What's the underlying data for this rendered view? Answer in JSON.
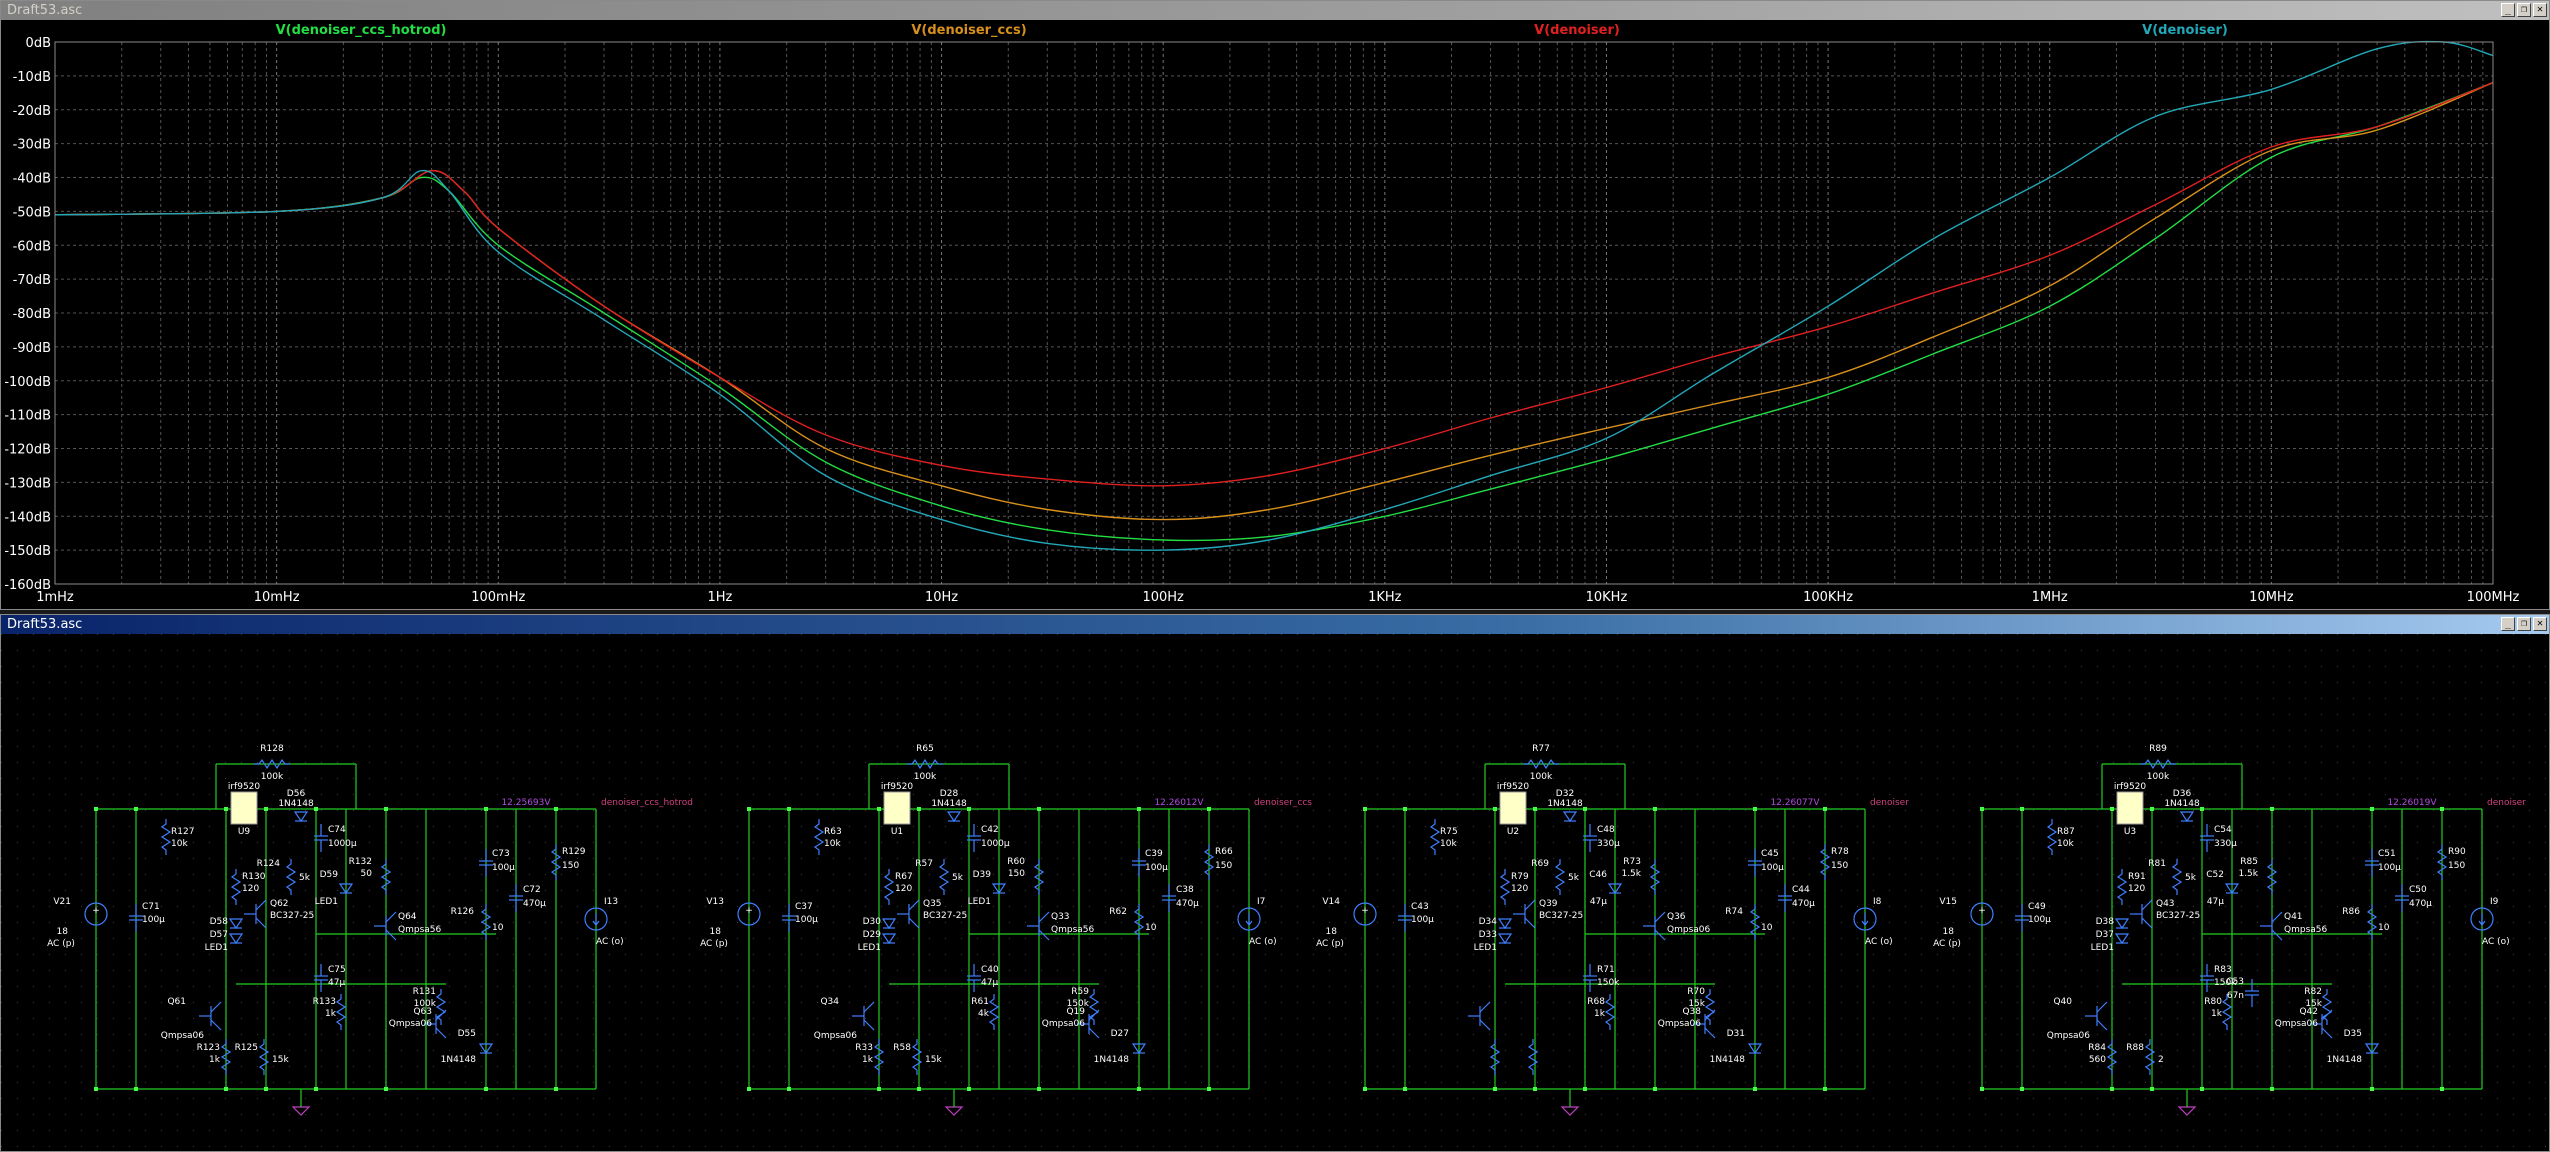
{
  "plot_window": {
    "title": "Draft53.asc"
  },
  "schematic_window": {
    "title": "Draft53.asc"
  },
  "window_controls": {
    "minimize": "_",
    "restore": "❐",
    "close": "✕"
  },
  "chart_data": {
    "type": "line",
    "title": "",
    "xlabel": "",
    "ylabel": "",
    "x_scale": "log",
    "xlim": [
      "1mHz",
      "100MHz"
    ],
    "ylim": [
      -160,
      0
    ],
    "grid": true,
    "legend": "top",
    "x_ticks": [
      "1mHz",
      "10mHz",
      "100mHz",
      "1Hz",
      "10Hz",
      "100Hz",
      "1KHz",
      "10KHz",
      "100KHz",
      "1MHz",
      "10MHz",
      "100MHz"
    ],
    "y_ticks": [
      "0dB",
      "-10dB",
      "-20dB",
      "-30dB",
      "-40dB",
      "-50dB",
      "-60dB",
      "-70dB",
      "-80dB",
      "-90dB",
      "-100dB",
      "-110dB",
      "-120dB",
      "-130dB",
      "-140dB",
      "-150dB",
      "-160dB"
    ],
    "series": [
      {
        "name": "V(denoiser_ccs_hotrod)",
        "color": "#22dd44",
        "x": [
          "1mHz",
          "10mHz",
          "30mHz",
          "45mHz",
          "60mHz",
          "100mHz",
          "300mHz",
          "1Hz",
          "3Hz",
          "10Hz",
          "30Hz",
          "100Hz",
          "300Hz",
          "1KHz",
          "3KHz",
          "10KHz",
          "30KHz",
          "100KHz",
          "300KHz",
          "1MHz",
          "3MHz",
          "10MHz",
          "30MHz",
          "100MHz"
        ],
        "y": [
          -51,
          -50,
          -46,
          -40,
          -44,
          -60,
          -80,
          -102,
          -124,
          -137,
          -144,
          -147,
          -146,
          -140,
          -132,
          -123,
          -114,
          -104,
          -92,
          -78,
          -58,
          -34,
          -25,
          -12
        ]
      },
      {
        "name": "V(denoiser_ccs)",
        "color": "#d8901c",
        "x": [
          "1mHz",
          "10mHz",
          "30mHz",
          "50mHz",
          "70mHz",
          "100mHz",
          "300mHz",
          "1Hz",
          "3Hz",
          "10Hz",
          "30Hz",
          "100Hz",
          "300Hz",
          "1KHz",
          "3KHz",
          "10KHz",
          "30KHz",
          "100KHz",
          "300KHz",
          "1MHz",
          "3MHz",
          "10MHz",
          "30MHz",
          "100MHz"
        ],
        "y": [
          -51,
          -50,
          -46,
          -38,
          -44,
          -55,
          -78,
          -99,
          -120,
          -131,
          -138,
          -141,
          -138,
          -130,
          -122,
          -114,
          -107,
          -99,
          -87,
          -72,
          -52,
          -32,
          -26,
          -12
        ]
      },
      {
        "name": "V(denoiser)",
        "color": "#e02020",
        "x": [
          "1mHz",
          "10mHz",
          "30mHz",
          "50mHz",
          "70mHz",
          "100mHz",
          "300mHz",
          "1Hz",
          "3Hz",
          "10Hz",
          "30Hz",
          "100Hz",
          "300Hz",
          "1KHz",
          "3KHz",
          "10KHz",
          "30KHz",
          "100KHz",
          "300KHz",
          "1MHz",
          "3MHz",
          "10MHz",
          "30MHz",
          "100MHz"
        ],
        "y": [
          -51,
          -50,
          -46,
          -38,
          -44,
          -55,
          -78,
          -99,
          -116,
          -125,
          -129,
          -131,
          -128,
          -120,
          -111,
          -102,
          -93,
          -84,
          -74,
          -63,
          -48,
          -31,
          -25,
          -12
        ]
      },
      {
        "name": "V(denoiser)",
        "color": "#22a8b8",
        "x": [
          "1mHz",
          "10mHz",
          "30mHz",
          "45mHz",
          "60mHz",
          "100mHz",
          "300mHz",
          "1Hz",
          "3Hz",
          "10Hz",
          "30Hz",
          "100Hz",
          "300Hz",
          "1KHz",
          "3KHz",
          "10KHz",
          "30KHz",
          "100KHz",
          "300KHz",
          "1MHz",
          "3MHz",
          "10MHz",
          "30MHz",
          "60MHz",
          "100MHz"
        ],
        "y": [
          -51,
          -50,
          -46,
          -38,
          -44,
          -62,
          -82,
          -104,
          -128,
          -141,
          -148,
          -150,
          -147,
          -138,
          -128,
          -117,
          -98,
          -78,
          -58,
          -40,
          -22,
          -14,
          -2,
          0,
          -4
        ]
      }
    ]
  },
  "schematic": {
    "circuits": [
      {
        "mosfet": "irf9520",
        "mos_ref": "U9",
        "rfb": "R128",
        "rfb_val": "100k",
        "rtop": "R127",
        "rtop_val": "10k",
        "vsrc": "V21",
        "vsrc_val": "18",
        "ac_label": "AC (p)",
        "cin": "C71",
        "cin_val": "100µ",
        "diode": "D56",
        "diode_val": "1N4148",
        "cfilt": "C74",
        "cfilt_val": "1000µ",
        "r3": "R130",
        "r3_val": "120",
        "q1": "Q62",
        "q1_val": "BC327-25",
        "led": "D58",
        "led2": "D57",
        "led_val": "LED1",
        "r4": "R124",
        "r4_val": "5k",
        "d3": "D59",
        "d3_val": "LED1",
        "r5": "R132",
        "r5_val": "50",
        "q2": "Q64",
        "q2_val": "Qmpsa56",
        "c3": "C73",
        "c3_val": "100µ",
        "r6": "R129",
        "r6_val": "150",
        "c4": "C72",
        "c4_val": "470µ",
        "r7": "R126",
        "r7_val": "10",
        "c5": "C75",
        "c5_val": "47µ",
        "r8": "R133",
        "r8_val": "1k",
        "r9": "R131",
        "r9_val": "100k",
        "q3": "Q63",
        "q3_val": "Qmpsa06",
        "d4": "D55",
        "d4_val": "1N4148",
        "q4": "Q61",
        "q4_val": "Qmpsa06",
        "r10": "R123",
        "r10_val": "1k",
        "r11": "R125",
        "r11_val": "15k",
        "isrc": "I13",
        "isrc_ac": "AC (o)",
        "voltage": "12.25693V",
        "net": "denoiser_ccs_hotrod"
      },
      {
        "mosfet": "irf9520",
        "mos_ref": "U1",
        "rfb": "R65",
        "rfb_val": "100k",
        "rtop": "R63",
        "rtop_val": "10k",
        "vsrc": "V13",
        "vsrc_val": "18",
        "ac_label": "AC (p)",
        "cin": "C37",
        "cin_val": "100µ",
        "diode": "D28",
        "diode_val": "1N4148",
        "cfilt": "C42",
        "cfilt_val": "1000µ",
        "r3": "R67",
        "r3_val": "120",
        "q1": "Q35",
        "q1_val": "BC327-25",
        "led": "D30",
        "led2": "D29",
        "led_val": "LED1",
        "r4": "R57",
        "r4_val": "5k",
        "d3": "D39",
        "d3_val": "LED1",
        "r5": "R60",
        "r5_val": "150",
        "q2": "Q33",
        "q2_val": "Qmpsa56",
        "c3": "C39",
        "c3_val": "100µ",
        "r6": "R66",
        "r6_val": "150",
        "c4": "C38",
        "c4_val": "470µ",
        "r7": "R62",
        "r7_val": "10",
        "c5": "C40",
        "c5_val": "47µ",
        "r8": "R61",
        "r8_val": "4k",
        "r9": "R59",
        "r9_val": "150k",
        "q3": "Q19",
        "q3_val": "Qmpsa06",
        "d4": "D27",
        "d4_val": "1N4148",
        "q4": "Q34",
        "q4_val": "Qmpsa06",
        "r10": "R33",
        "r10_val": "1k",
        "r11": "R58",
        "r11_val": "15k",
        "isrc": "I7",
        "isrc_ac": "AC (o)",
        "voltage": "12.26012V",
        "net": "denoiser_ccs"
      },
      {
        "mosfet": "irf9520",
        "mos_ref": "U2",
        "rfb": "R77",
        "rfb_val": "100k",
        "rtop": "R75",
        "rtop_val": "10k",
        "vsrc": "V14",
        "vsrc_val": "18",
        "ac_label": "AC (p)",
        "cin": "C43",
        "cin_val": "100µ",
        "diode": "D32",
        "diode_val": "1N4148",
        "cfilt": "C48",
        "cfilt_val": "330µ",
        "r3": "R79",
        "r3_val": "120",
        "q1": "Q39",
        "q1_val": "BC327-25",
        "led": "D34",
        "led2": "D33",
        "led_val": "LED1",
        "r4": "R69",
        "r4_val": "5k",
        "d3": "C46",
        "d3_val": "47µ",
        "r5": "R73",
        "r5_val": "1.5k",
        "q2": "Q36",
        "q2_val": "Qmpsa06",
        "c3": "C45",
        "c3_val": "100µ",
        "r6": "R78",
        "r6_val": "150",
        "c4": "C44",
        "c4_val": "470µ",
        "r7": "R74",
        "r7_val": "10",
        "c5": "R71",
        "c5_val": "150k",
        "r8": "R68",
        "r8_val": "1k",
        "r9": "R70",
        "r9_val": "15k",
        "q3": "Q38",
        "q3_val": "Qmpsa06",
        "d4": "D31",
        "d4_val": "1N4148",
        "q4": "",
        "q4_val": "",
        "r10": "",
        "r10_val": "",
        "r11": "",
        "r11_val": "",
        "isrc": "I8",
        "isrc_ac": "AC (o)",
        "voltage": "12.26077V",
        "net": "denoiser"
      },
      {
        "mosfet": "irf9520",
        "mos_ref": "U3",
        "rfb": "R89",
        "rfb_val": "100k",
        "rtop": "R87",
        "rtop_val": "10k",
        "vsrc": "V15",
        "vsrc_val": "18",
        "ac_label": "AC (p)",
        "cin": "C49",
        "cin_val": "100µ",
        "diode": "D36",
        "diode_val": "1N4148",
        "cfilt": "C54",
        "cfilt_val": "330µ",
        "r3": "R91",
        "r3_val": "120",
        "q1": "Q43",
        "q1_val": "BC327-25",
        "led": "D38",
        "led2": "D37",
        "led_val": "LED1",
        "r4": "R81",
        "r4_val": "5k",
        "d3": "C52",
        "d3_val": "47µ",
        "r5": "R85",
        "r5_val": "1.5k",
        "q2": "Q41",
        "q2_val": "Qmpsa56",
        "c3": "C51",
        "c3_val": "100µ",
        "r6": "R90",
        "r6_val": "150",
        "c4": "C50",
        "c4_val": "470µ",
        "r7": "R86",
        "r7_val": "10",
        "c5": "R83",
        "c5_val": "150k",
        "r8": "R80",
        "r8_val": "1k",
        "r9": "R82",
        "r9_val": "15k",
        "q3": "Q42",
        "q3_val": "Qmpsa06",
        "d4": "D35",
        "d4_val": "1N4148",
        "q4": "Q40",
        "q4_val": "Qmpsa06",
        "r10": "R84",
        "r10_val": "560",
        "r11": "R88",
        "r11_val": "2",
        "isrc": "I9",
        "isrc_ac": "AC (o)",
        "voltage": "12.26019V",
        "net": "denoiser",
        "extra_c": "C53",
        "extra_c_val": "67n"
      }
    ]
  }
}
